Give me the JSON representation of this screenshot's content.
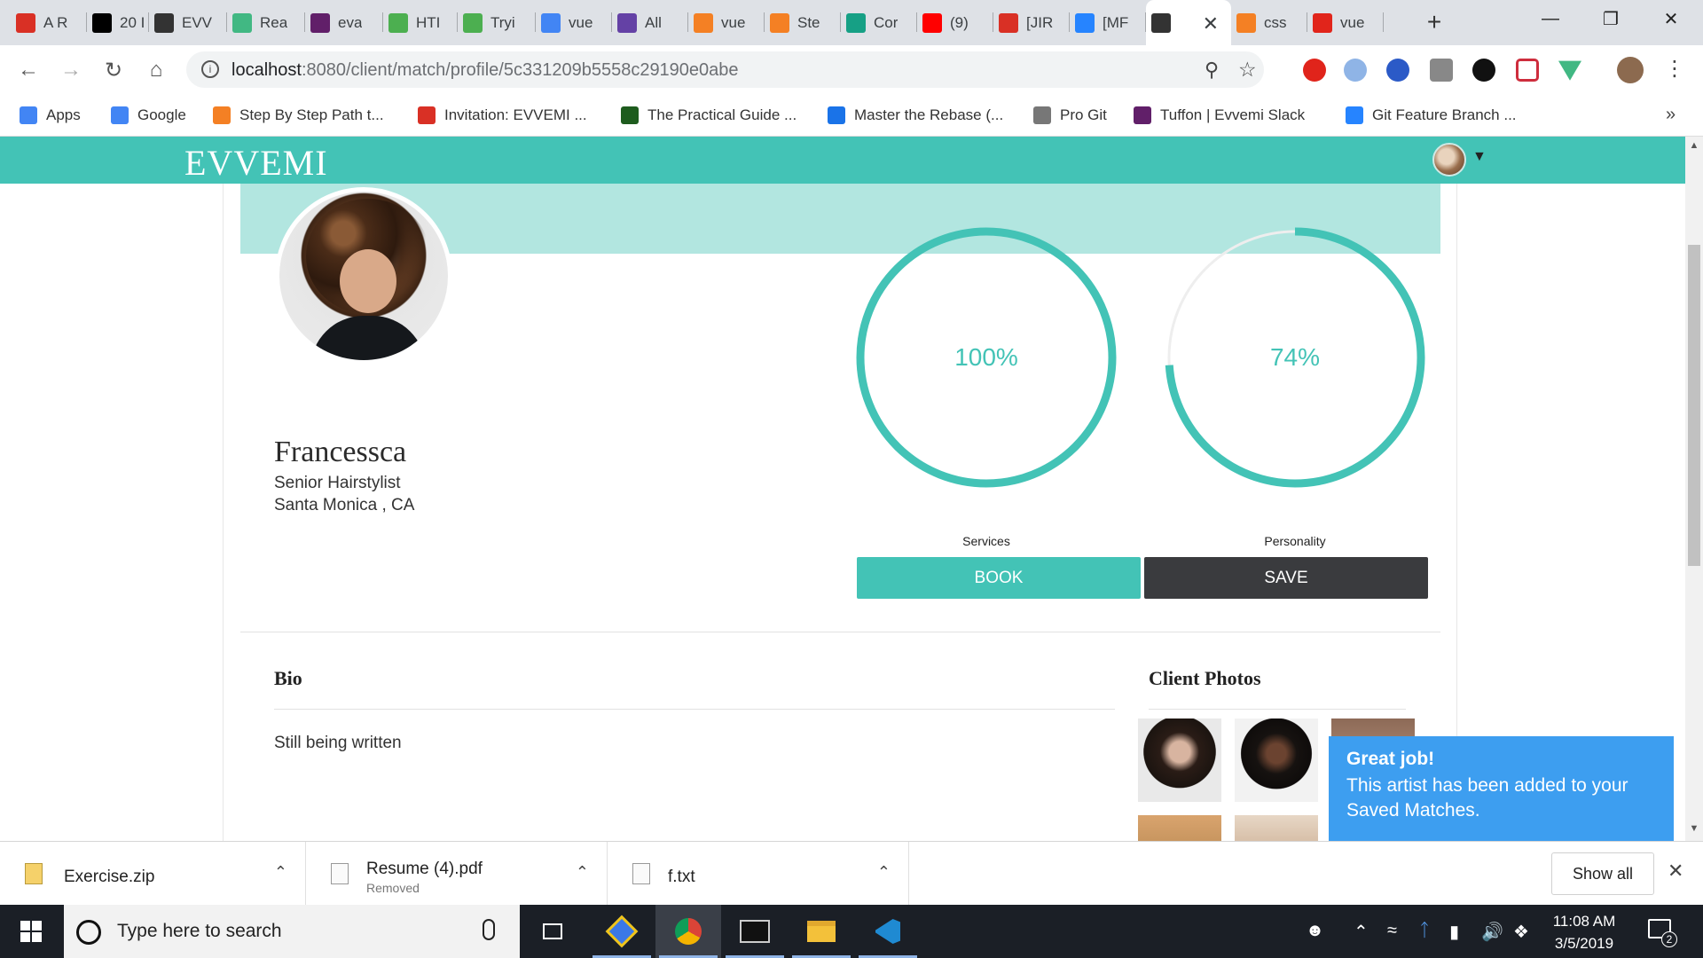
{
  "browser": {
    "tabs": [
      {
        "label": "A R",
        "icon": "gmail-icon",
        "color": "#d93025"
      },
      {
        "label": "20 I",
        "icon": "inc-icon",
        "color": "#000000"
      },
      {
        "label": "EVV",
        "icon": "evvemi-icon",
        "color": "#333333"
      },
      {
        "label": "Rea",
        "icon": "vue-icon",
        "color": "#41b883"
      },
      {
        "label": "eva",
        "icon": "slack-icon",
        "color": "#611f69"
      },
      {
        "label": "HTI",
        "icon": "w3schools-icon",
        "color": "#4caf50"
      },
      {
        "label": "Tryi",
        "icon": "w3schools-icon",
        "color": "#4caf50"
      },
      {
        "label": "vue",
        "icon": "google-icon",
        "color": "#4285f4"
      },
      {
        "label": "All",
        "icon": "twitch-icon",
        "color": "#6441a5"
      },
      {
        "label": "vue",
        "icon": "stackoverflow-icon",
        "color": "#f48024"
      },
      {
        "label": "Ste",
        "icon": "sp-icon",
        "color": "#f48024"
      },
      {
        "label": "Cor",
        "icon": "shield-icon",
        "color": "#16a085"
      },
      {
        "label": "(9)",
        "icon": "youtube-icon",
        "color": "#ff0000"
      },
      {
        "label": "[JIR",
        "icon": "gmail-icon",
        "color": "#d93025"
      },
      {
        "label": "[MF",
        "icon": "jira-icon",
        "color": "#2684ff"
      },
      {
        "label": "",
        "icon": "evvemi-icon",
        "color": "#333333"
      },
      {
        "label": "css",
        "icon": "stackoverflow-icon",
        "color": "#f48024"
      },
      {
        "label": "vue",
        "icon": "red-square-icon",
        "color": "#e1251b"
      }
    ],
    "url_host": "localhost",
    "url_path": ":8080/client/match/profile/5c331209b5558c29190e0abe",
    "bookmarks": [
      {
        "label": "Apps",
        "icon": "apps-grid-icon",
        "color": "#4285f4"
      },
      {
        "label": "Google",
        "icon": "google-icon",
        "color": "#4285f4"
      },
      {
        "label": "Step By Step Path t...",
        "icon": "sp-icon",
        "color": "#f48024"
      },
      {
        "label": "Invitation: EVVEMI ...",
        "icon": "gmail-icon",
        "color": "#d93025"
      },
      {
        "label": "The Practical Guide ...",
        "icon": "udemy-icon",
        "color": "#1e5c1e"
      },
      {
        "label": "Master the Rebase (...",
        "icon": "clock-icon",
        "color": "#1a73e8"
      },
      {
        "label": "Pro Git",
        "icon": "page-icon",
        "color": "#777777"
      },
      {
        "label": "Tuffon | Evvemi Slack",
        "icon": "slack-icon",
        "color": "#611f69"
      },
      {
        "label": "Git Feature Branch ...",
        "icon": "atlassian-icon",
        "color": "#2684ff"
      }
    ]
  },
  "site": {
    "brand": "EVVEMI",
    "accent": "#43c3b6",
    "banner": "#b2e6e0"
  },
  "profile": {
    "name": "Francessca",
    "role": "Senior Hairstylist",
    "location": "Santa Monica , CA",
    "metrics": [
      {
        "label": "Services",
        "percent_text": "100%",
        "value": 100
      },
      {
        "label": "Personality",
        "percent_text": "74%",
        "value": 74
      }
    ],
    "book_label": "BOOK",
    "save_label": "SAVE",
    "bio_heading": "Bio",
    "bio_text": "Still being written",
    "photos_heading": "Client Photos"
  },
  "toast": {
    "title": "Great job!",
    "message": "This artist has been added to your Saved Matches."
  },
  "downloads": {
    "items": [
      {
        "name": "Exercise.zip",
        "status": ""
      },
      {
        "name": "Resume (4).pdf",
        "status": "Removed"
      },
      {
        "name": "f.txt",
        "status": ""
      }
    ],
    "show_all": "Show all"
  },
  "taskbar": {
    "search_placeholder": "Type here to search",
    "time": "11:08 AM",
    "date": "3/5/2019",
    "notifications": "2"
  }
}
